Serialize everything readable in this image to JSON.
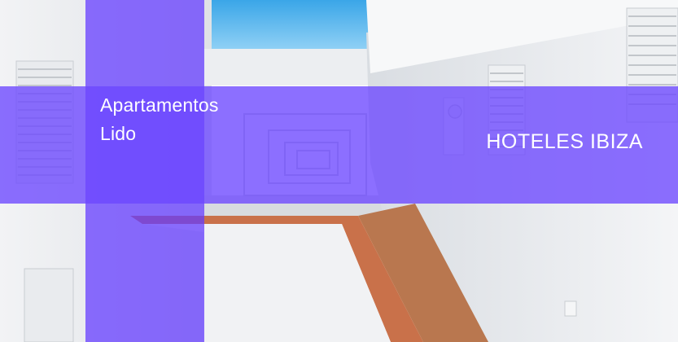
{
  "hero": {
    "scene": "hotel-courtyard-photo",
    "accent_color": "#6a45ff"
  },
  "title": {
    "line1": "Apartamentos",
    "line2": "Lido"
  },
  "category": {
    "label": "HOTELES IBIZA"
  }
}
